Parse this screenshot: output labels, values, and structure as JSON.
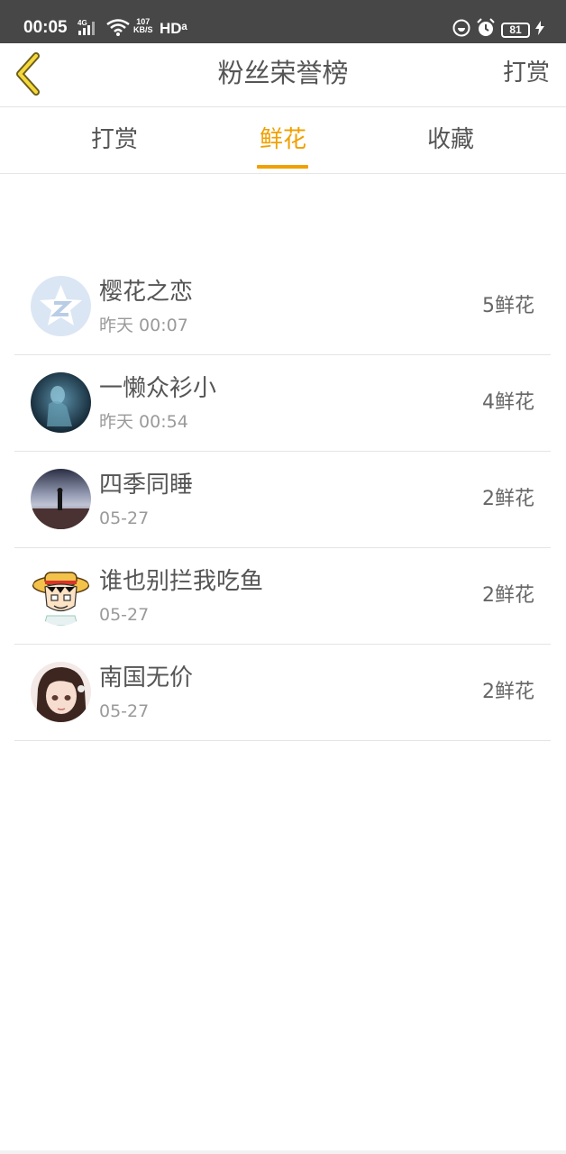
{
  "status_bar": {
    "time": "00:05",
    "network": "4G",
    "speed_value": "107",
    "speed_unit": "KB/S",
    "hd": "HDᵃ",
    "battery": "81"
  },
  "header": {
    "title": "粉丝荣誉榜",
    "reward_label": "打赏"
  },
  "tabs": [
    {
      "label": "打赏",
      "active": false
    },
    {
      "label": "鲜花",
      "active": true
    },
    {
      "label": "收藏",
      "active": false
    }
  ],
  "colors": {
    "accent": "#f0a000",
    "status_bar": "#474747",
    "text": "#555555",
    "subtext": "#9a9a9a"
  },
  "fans": [
    {
      "name": "樱花之恋",
      "date": "昨天 00:07",
      "count": "5鲜花",
      "avatar": "qq-default-avatar"
    },
    {
      "name": "一懒众衫小",
      "date": "昨天 00:54",
      "count": "4鲜花",
      "avatar": "dark-blue-figure-avatar"
    },
    {
      "name": "四季同睡",
      "date": "05-27",
      "count": "2鲜花",
      "avatar": "sunset-silhouette-avatar"
    },
    {
      "name": "谁也别拦我吃鱼",
      "date": "05-27",
      "count": "2鲜花",
      "avatar": "straw-hat-cartoon-avatar"
    },
    {
      "name": "南国无价",
      "date": "05-27",
      "count": "2鲜花",
      "avatar": "anime-girl-avatar"
    }
  ]
}
